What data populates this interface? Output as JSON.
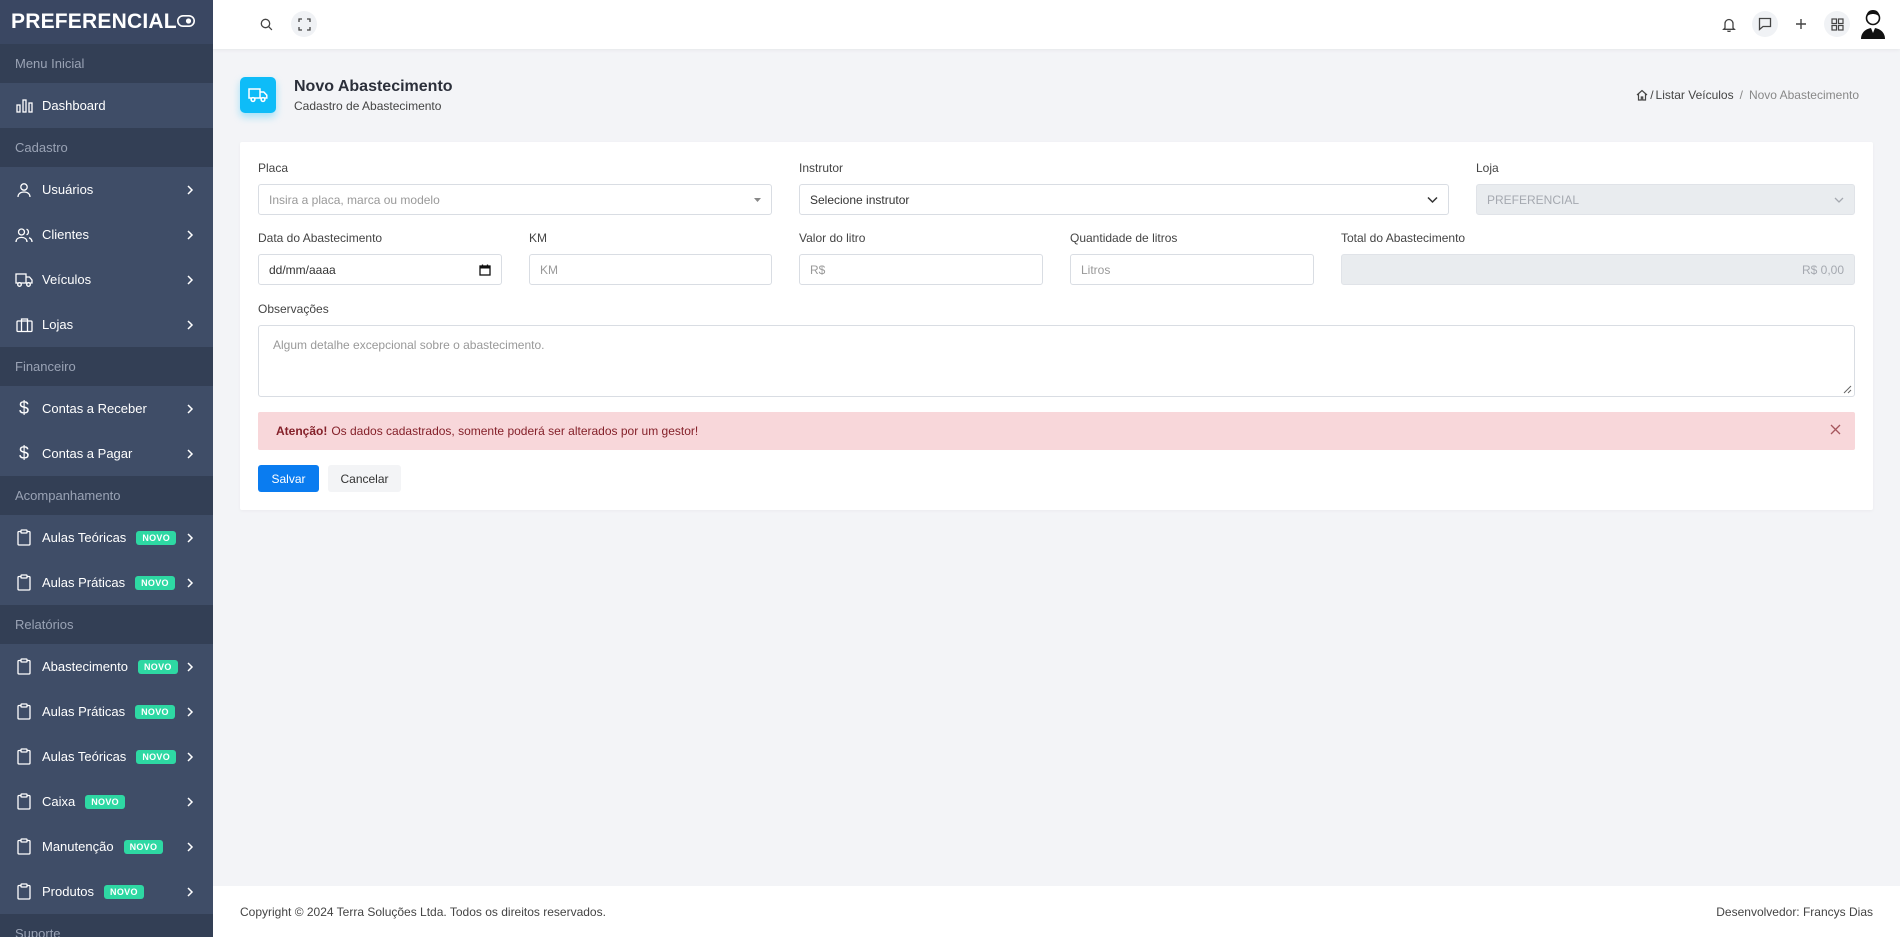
{
  "brand": {
    "name": "PREFERENCIAL"
  },
  "sidebar": {
    "menu_section": "Menu Inicial",
    "dashboard": "Dashboard",
    "cadastro_section": "Cadastro",
    "cadastro_items": [
      {
        "label": "Usuários",
        "icon": "user-icon"
      },
      {
        "label": "Clientes",
        "icon": "users-icon"
      },
      {
        "label": "Veículos",
        "icon": "truck-icon"
      },
      {
        "label": "Lojas",
        "icon": "briefcase-icon"
      }
    ],
    "financeiro_section": "Financeiro",
    "financeiro_items": [
      {
        "label": "Contas a Receber",
        "icon": "dollar-icon"
      },
      {
        "label": "Contas a Pagar",
        "icon": "dollar-icon"
      }
    ],
    "acomp_section": "Acompanhamento",
    "acomp_items": [
      {
        "label": "Aulas Teóricas",
        "badge": "NOVO"
      },
      {
        "label": "Aulas Práticas",
        "badge": "NOVO"
      }
    ],
    "relatorios_section": "Relatórios",
    "relatorios_items": [
      {
        "label": "Abastecimento",
        "badge": "NOVO"
      },
      {
        "label": "Aulas Práticas",
        "badge": "NOVO"
      },
      {
        "label": "Aulas Teóricas",
        "badge": "NOVO"
      },
      {
        "label": "Caixa",
        "badge": "NOVO"
      },
      {
        "label": "Manutenção",
        "badge": "NOVO"
      },
      {
        "label": "Produtos",
        "badge": "NOVO"
      }
    ],
    "suporte_section": "Suporte"
  },
  "header": {
    "title": "Novo Abastecimento",
    "subtitle": "Cadastro de Abastecimento",
    "breadcrumb": {
      "prefix": "/",
      "parent": "Listar Veículos",
      "separator": "/",
      "current": "Novo Abastecimento"
    }
  },
  "form": {
    "placa": {
      "label": "Placa",
      "placeholder": "Insira a placa, marca ou modelo"
    },
    "instrutor": {
      "label": "Instrutor",
      "value": "Selecione instrutor"
    },
    "loja": {
      "label": "Loja",
      "value": "PREFERENCIAL"
    },
    "data": {
      "label": "Data do Abastecimento",
      "placeholder": "dd/mm/aaaa"
    },
    "km": {
      "label": "KM",
      "placeholder": "KM"
    },
    "valor": {
      "label": "Valor do litro",
      "placeholder": "R$"
    },
    "quantidade": {
      "label": "Quantidade de litros",
      "placeholder": "Litros"
    },
    "total": {
      "label": "Total do Abastecimento",
      "value": "R$ 0,00"
    },
    "observacoes": {
      "label": "Observações",
      "placeholder": "Algum detalhe excepcional sobre o abastecimento."
    }
  },
  "alert": {
    "strong": "Atenção!",
    "text": "Os dados cadastrados, somente poderá ser alterados por um gestor!"
  },
  "actions": {
    "save": "Salvar",
    "cancel": "Cancelar"
  },
  "footer": {
    "copyright": "Copyright © 2024 Terra Soluções Ltda. Todos os direitos reservados.",
    "developer": "Desenvolvedor: Francys Dias"
  },
  "colors": {
    "sidebar": "#3f4d67",
    "section": "#333f55",
    "accent": "#0a7cf0",
    "head_icon": "#0ebcf8",
    "badge": "#2ed8a3",
    "alert_bg": "#f8d7da"
  }
}
